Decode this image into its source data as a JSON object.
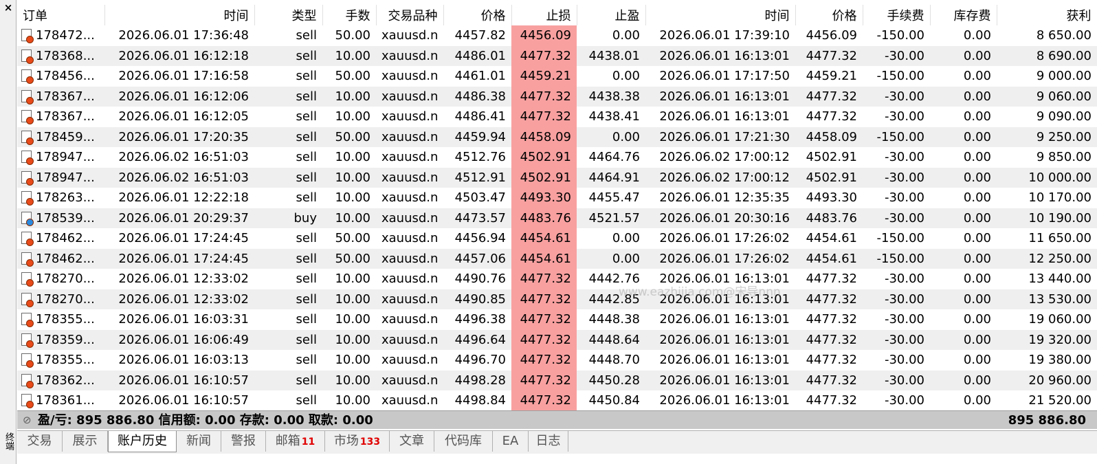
{
  "sidebar": {
    "close_label": "×",
    "vertical_label": "终端"
  },
  "table": {
    "headers": [
      {
        "label": "订单",
        "align": "l"
      },
      {
        "label": "时间",
        "align": "r"
      },
      {
        "label": "类型",
        "align": "r"
      },
      {
        "label": "手数",
        "align": "r"
      },
      {
        "label": "交易品种",
        "align": "r"
      },
      {
        "label": "价格",
        "align": "r"
      },
      {
        "label": "止损",
        "align": "r"
      },
      {
        "label": "止盈",
        "align": "r"
      },
      {
        "label": "时间",
        "align": "r"
      },
      {
        "label": "价格",
        "align": "r"
      },
      {
        "label": "手续费",
        "align": "r"
      },
      {
        "label": "库存费",
        "align": "r"
      },
      {
        "label": "获利",
        "align": "r"
      }
    ],
    "rows": [
      {
        "order": "178472...",
        "open_time": "2026.06.01 17:36:48",
        "type": "sell",
        "volume": "50.00",
        "symbol": "xauusd.n",
        "open_price": "4457.82",
        "sl": "4456.09",
        "tp": "0.00",
        "close_time": "2026.06.01 17:39:10",
        "close_price": "4456.09",
        "commission": "-150.00",
        "swap": "0.00",
        "profit": "8 650.00"
      },
      {
        "order": "178368...",
        "open_time": "2026.06.01 16:12:18",
        "type": "sell",
        "volume": "10.00",
        "symbol": "xauusd.n",
        "open_price": "4486.01",
        "sl": "4477.32",
        "tp": "4438.01",
        "close_time": "2026.06.01 16:13:01",
        "close_price": "4477.32",
        "commission": "-30.00",
        "swap": "0.00",
        "profit": "8 690.00"
      },
      {
        "order": "178456...",
        "open_time": "2026.06.01 17:16:58",
        "type": "sell",
        "volume": "50.00",
        "symbol": "xauusd.n",
        "open_price": "4461.01",
        "sl": "4459.21",
        "tp": "0.00",
        "close_time": "2026.06.01 17:17:50",
        "close_price": "4459.21",
        "commission": "-150.00",
        "swap": "0.00",
        "profit": "9 000.00"
      },
      {
        "order": "178367...",
        "open_time": "2026.06.01 16:12:06",
        "type": "sell",
        "volume": "10.00",
        "symbol": "xauusd.n",
        "open_price": "4486.38",
        "sl": "4477.32",
        "tp": "4438.38",
        "close_time": "2026.06.01 16:13:01",
        "close_price": "4477.32",
        "commission": "-30.00",
        "swap": "0.00",
        "profit": "9 060.00"
      },
      {
        "order": "178367...",
        "open_time": "2026.06.01 16:12:05",
        "type": "sell",
        "volume": "10.00",
        "symbol": "xauusd.n",
        "open_price": "4486.41",
        "sl": "4477.32",
        "tp": "4438.41",
        "close_time": "2026.06.01 16:13:01",
        "close_price": "4477.32",
        "commission": "-30.00",
        "swap": "0.00",
        "profit": "9 090.00"
      },
      {
        "order": "178459...",
        "open_time": "2026.06.01 17:20:35",
        "type": "sell",
        "volume": "50.00",
        "symbol": "xauusd.n",
        "open_price": "4459.94",
        "sl": "4458.09",
        "tp": "0.00",
        "close_time": "2026.06.01 17:21:30",
        "close_price": "4458.09",
        "commission": "-150.00",
        "swap": "0.00",
        "profit": "9 250.00"
      },
      {
        "order": "178947...",
        "open_time": "2026.06.02 16:51:03",
        "type": "sell",
        "volume": "10.00",
        "symbol": "xauusd.n",
        "open_price": "4512.76",
        "sl": "4502.91",
        "tp": "4464.76",
        "close_time": "2026.06.02 17:00:12",
        "close_price": "4502.91",
        "commission": "-30.00",
        "swap": "0.00",
        "profit": "9 850.00"
      },
      {
        "order": "178947...",
        "open_time": "2026.06.02 16:51:03",
        "type": "sell",
        "volume": "10.00",
        "symbol": "xauusd.n",
        "open_price": "4512.91",
        "sl": "4502.91",
        "tp": "4464.91",
        "close_time": "2026.06.02 17:00:12",
        "close_price": "4502.91",
        "commission": "-30.00",
        "swap": "0.00",
        "profit": "10 000.00"
      },
      {
        "order": "178263...",
        "open_time": "2026.06.01 12:22:18",
        "type": "sell",
        "volume": "10.00",
        "symbol": "xauusd.n",
        "open_price": "4503.47",
        "sl": "4493.30",
        "tp": "4455.47",
        "close_time": "2026.06.01 12:35:35",
        "close_price": "4493.30",
        "commission": "-30.00",
        "swap": "0.00",
        "profit": "10 170.00"
      },
      {
        "order": "178539...",
        "open_time": "2026.06.01 20:29:37",
        "type": "buy",
        "volume": "10.00",
        "symbol": "xauusd.n",
        "open_price": "4473.57",
        "sl": "4483.76",
        "tp": "4521.57",
        "close_time": "2026.06.01 20:30:16",
        "close_price": "4483.76",
        "commission": "-30.00",
        "swap": "0.00",
        "profit": "10 190.00"
      },
      {
        "order": "178462...",
        "open_time": "2026.06.01 17:24:45",
        "type": "sell",
        "volume": "50.00",
        "symbol": "xauusd.n",
        "open_price": "4456.94",
        "sl": "4454.61",
        "tp": "0.00",
        "close_time": "2026.06.01 17:26:02",
        "close_price": "4454.61",
        "commission": "-150.00",
        "swap": "0.00",
        "profit": "11 650.00"
      },
      {
        "order": "178462...",
        "open_time": "2026.06.01 17:24:45",
        "type": "sell",
        "volume": "50.00",
        "symbol": "xauusd.n",
        "open_price": "4457.06",
        "sl": "4454.61",
        "tp": "0.00",
        "close_time": "2026.06.01 17:26:02",
        "close_price": "4454.61",
        "commission": "-150.00",
        "swap": "0.00",
        "profit": "12 250.00"
      },
      {
        "order": "178270...",
        "open_time": "2026.06.01 12:33:02",
        "type": "sell",
        "volume": "10.00",
        "symbol": "xauusd.n",
        "open_price": "4490.76",
        "sl": "4477.32",
        "tp": "4442.76",
        "close_time": "2026.06.01 16:13:01",
        "close_price": "4477.32",
        "commission": "-30.00",
        "swap": "0.00",
        "profit": "13 440.00"
      },
      {
        "order": "178270...",
        "open_time": "2026.06.01 12:33:02",
        "type": "sell",
        "volume": "10.00",
        "symbol": "xauusd.n",
        "open_price": "4490.85",
        "sl": "4477.32",
        "tp": "4442.85",
        "close_time": "2026.06.01 16:13:01",
        "close_price": "4477.32",
        "commission": "-30.00",
        "swap": "0.00",
        "profit": "13 530.00"
      },
      {
        "order": "178355...",
        "open_time": "2026.06.01 16:03:31",
        "type": "sell",
        "volume": "10.00",
        "symbol": "xauusd.n",
        "open_price": "4496.38",
        "sl": "4477.32",
        "tp": "4448.38",
        "close_time": "2026.06.01 16:13:01",
        "close_price": "4477.32",
        "commission": "-30.00",
        "swap": "0.00",
        "profit": "19 060.00"
      },
      {
        "order": "178359...",
        "open_time": "2026.06.01 16:06:49",
        "type": "sell",
        "volume": "10.00",
        "symbol": "xauusd.n",
        "open_price": "4496.64",
        "sl": "4477.32",
        "tp": "4448.64",
        "close_time": "2026.06.01 16:13:01",
        "close_price": "4477.32",
        "commission": "-30.00",
        "swap": "0.00",
        "profit": "19 320.00"
      },
      {
        "order": "178355...",
        "open_time": "2026.06.01 16:03:13",
        "type": "sell",
        "volume": "10.00",
        "symbol": "xauusd.n",
        "open_price": "4496.70",
        "sl": "4477.32",
        "tp": "4448.70",
        "close_time": "2026.06.01 16:13:01",
        "close_price": "4477.32",
        "commission": "-30.00",
        "swap": "0.00",
        "profit": "19 380.00"
      },
      {
        "order": "178362...",
        "open_time": "2026.06.01 16:10:57",
        "type": "sell",
        "volume": "10.00",
        "symbol": "xauusd.n",
        "open_price": "4498.28",
        "sl": "4477.32",
        "tp": "4450.28",
        "close_time": "2026.06.01 16:13:01",
        "close_price": "4477.32",
        "commission": "-30.00",
        "swap": "0.00",
        "profit": "20 960.00"
      },
      {
        "order": "178361...",
        "open_time": "2026.06.01 16:10:57",
        "type": "sell",
        "volume": "10.00",
        "symbol": "xauusd.n",
        "open_price": "4498.84",
        "sl": "4477.32",
        "tp": "4450.84",
        "close_time": "2026.06.01 16:13:01",
        "close_price": "4477.32",
        "commission": "-30.00",
        "swap": "0.00",
        "profit": "21 520.00"
      }
    ]
  },
  "summary": {
    "text": "盈/亏: 895 886.80  信用额: 0.00  存款: 0.00  取款: 0.00",
    "total": "895 886.80"
  },
  "tabs": [
    {
      "label": "交易",
      "badge": "",
      "active": false
    },
    {
      "label": "展示",
      "badge": "",
      "active": false
    },
    {
      "label": "账户历史",
      "badge": "",
      "active": true
    },
    {
      "label": "新闻",
      "badge": "",
      "active": false
    },
    {
      "label": "警报",
      "badge": "",
      "active": false
    },
    {
      "label": "邮箱",
      "badge": "11",
      "active": false
    },
    {
      "label": "市场",
      "badge": "133",
      "active": false
    },
    {
      "label": "文章",
      "badge": "",
      "active": false
    },
    {
      "label": "代码库",
      "badge": "",
      "active": false
    },
    {
      "label": "EA",
      "badge": "",
      "active": false
    },
    {
      "label": "日志",
      "badge": "",
      "active": false
    }
  ],
  "watermark": "www.eazhijia.com@宋导nnn",
  "colors": {
    "stop_loss_highlight": "#f8a0a0",
    "sell_marker": "#e84a1a",
    "buy_marker": "#2a8ae0",
    "badge": "#e00000"
  }
}
